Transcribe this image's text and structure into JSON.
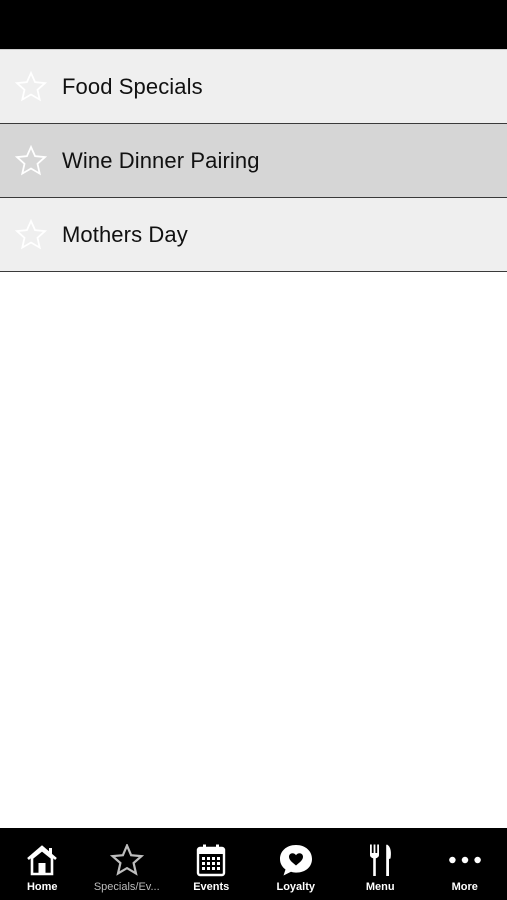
{
  "list": {
    "items": [
      {
        "label": "Food Specials",
        "icon": "star-outline-icon",
        "selected": false
      },
      {
        "label": "Wine Dinner Pairing",
        "icon": "star-outline-icon",
        "selected": true
      },
      {
        "label": "Mothers Day",
        "icon": "star-outline-icon",
        "selected": false
      }
    ]
  },
  "tabbar": {
    "tabs": [
      {
        "label": "Home",
        "icon": "home-icon",
        "active": false
      },
      {
        "label": "Specials/Ev...",
        "icon": "star-outline-icon",
        "active": true
      },
      {
        "label": "Events",
        "icon": "calendar-icon",
        "active": false
      },
      {
        "label": "Loyalty",
        "icon": "heart-bubble-icon",
        "active": false
      },
      {
        "label": "Menu",
        "icon": "fork-knife-icon",
        "active": false
      },
      {
        "label": "More",
        "icon": "more-dots-icon",
        "active": false
      }
    ]
  },
  "colors": {
    "status_bar": "#000000",
    "tab_bar": "#000000",
    "list_item_bg": "#efefef",
    "list_item_selected_bg": "#d6d6d6",
    "tab_label": "#ffffff",
    "tab_label_active": "#bdbdbd"
  }
}
